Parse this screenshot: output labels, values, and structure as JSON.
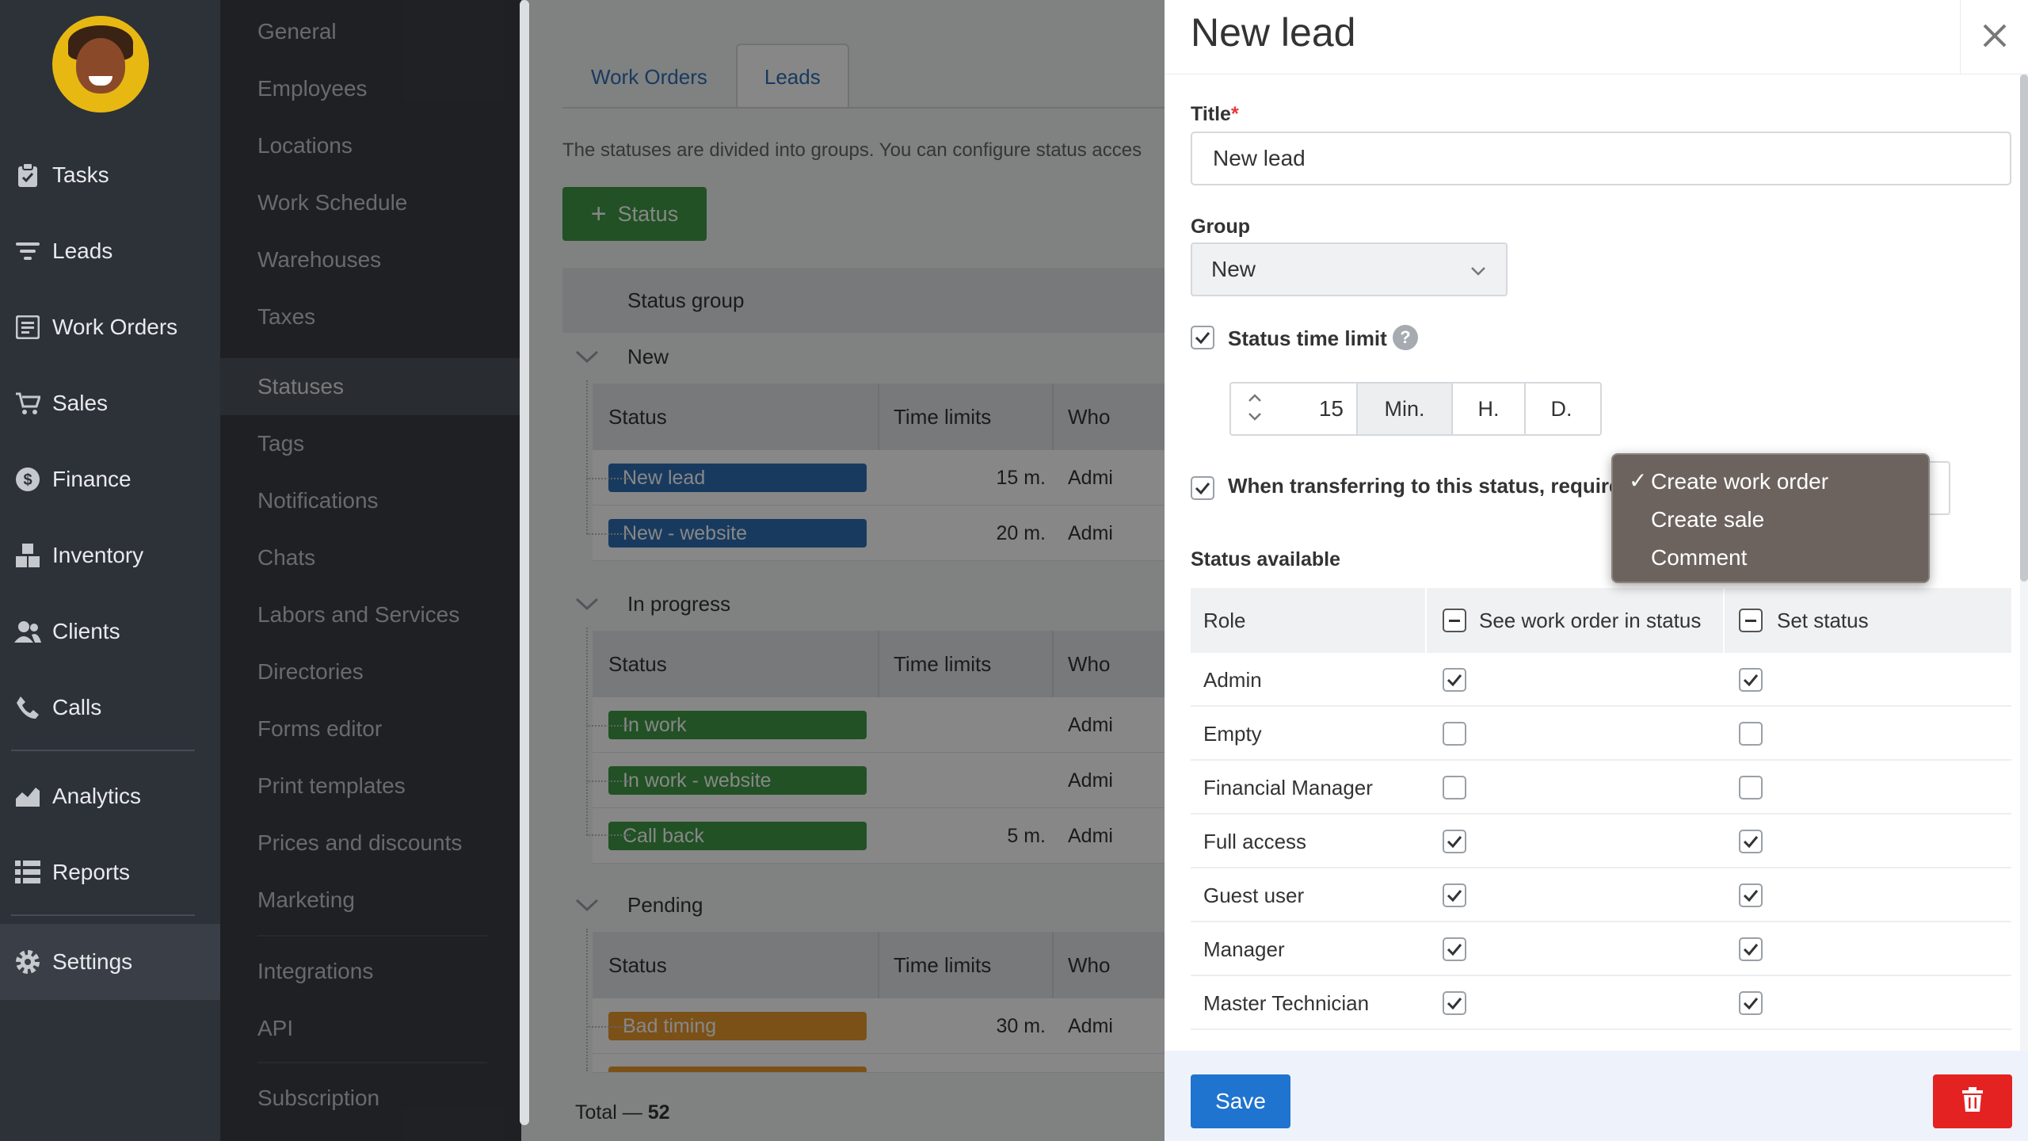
{
  "nav": {
    "items": [
      {
        "label": "Tasks",
        "icon": "clipboard-icon"
      },
      {
        "label": "Leads",
        "icon": "funnel-icon"
      },
      {
        "label": "Work Orders",
        "icon": "document-icon"
      },
      {
        "label": "Sales",
        "icon": "cart-icon"
      },
      {
        "label": "Finance",
        "icon": "dollar-icon"
      },
      {
        "label": "Inventory",
        "icon": "boxes-icon"
      },
      {
        "label": "Clients",
        "icon": "users-icon"
      },
      {
        "label": "Calls",
        "icon": "phone-icon"
      },
      {
        "label": "Analytics",
        "icon": "chart-icon"
      },
      {
        "label": "Reports",
        "icon": "list-icon"
      },
      {
        "label": "Settings",
        "icon": "gear-icon"
      }
    ],
    "active": "Settings"
  },
  "submenu": {
    "items": [
      "General",
      "Employees",
      "Locations",
      "Work Schedule",
      "Warehouses",
      "Taxes",
      "Statuses",
      "Tags",
      "Notifications",
      "Chats",
      "Labors and Services",
      "Directories",
      "Forms editor",
      "Print templates",
      "Prices and discounts",
      "Marketing",
      "Integrations",
      "API",
      "Subscription"
    ],
    "active": "Statuses"
  },
  "main": {
    "tabs": [
      "Work Orders",
      "Leads"
    ],
    "active_tab": "Leads",
    "intro": "The statuses are divided into groups. You can configure status acces",
    "add_button": "Status",
    "table_header": "Status group",
    "sub_headers": {
      "status": "Status",
      "time_limits": "Time limits",
      "who": "Who"
    },
    "groups": [
      {
        "name": "New",
        "rows": [
          {
            "label": "New lead",
            "time": "15 m.",
            "who": "Admi",
            "color": "#2f6fb3"
          },
          {
            "label": "New - website",
            "time": "20 m.",
            "who": "Admi",
            "color": "#2f6fb3"
          }
        ]
      },
      {
        "name": "In progress",
        "rows": [
          {
            "label": "In work",
            "time": "",
            "who": "Admi",
            "color": "#3f9a45"
          },
          {
            "label": "In work - website",
            "time": "",
            "who": "Admi",
            "color": "#3f9a45"
          },
          {
            "label": "Call back",
            "time": "5 m.",
            "who": "Admi",
            "color": "#3f9a45"
          }
        ]
      },
      {
        "name": "Pending",
        "rows": [
          {
            "label": "Bad timing",
            "time": "30 m.",
            "who": "Admi",
            "color": "#e89a2f"
          }
        ]
      }
    ],
    "total_label": "Total —",
    "total_value": "52"
  },
  "panel": {
    "title": "New lead",
    "title_label": "Title",
    "title_value": "New lead",
    "group_label": "Group",
    "group_value": "New",
    "time_limit_label": "Status time limit",
    "time_limit_value": "15",
    "units": [
      "Min.",
      "H.",
      "D."
    ],
    "active_unit": "Min.",
    "transfer_label": "When transferring to this status, require",
    "dropdown_options": [
      "Create work order",
      "Create sale",
      "Comment"
    ],
    "dropdown_selected": "Create work order",
    "status_available_label": "Status available",
    "roles_headers": {
      "role": "Role",
      "see": "See work order in status",
      "set": "Set status"
    },
    "roles": [
      {
        "name": "Admin",
        "see": true,
        "set": true
      },
      {
        "name": "Empty",
        "see": false,
        "set": false
      },
      {
        "name": "Financial Manager",
        "see": false,
        "set": false
      },
      {
        "name": "Full access",
        "see": true,
        "set": true
      },
      {
        "name": "Guest user",
        "see": true,
        "set": true
      },
      {
        "name": "Manager",
        "see": true,
        "set": true
      },
      {
        "name": "Master Technician",
        "see": true,
        "set": true
      }
    ],
    "save_label": "Save"
  },
  "help_glyph": "?",
  "colors": {
    "primary": "#1f74d0",
    "danger": "#e52222",
    "success": "#3f9a45",
    "sidebar": "#2d3138"
  }
}
